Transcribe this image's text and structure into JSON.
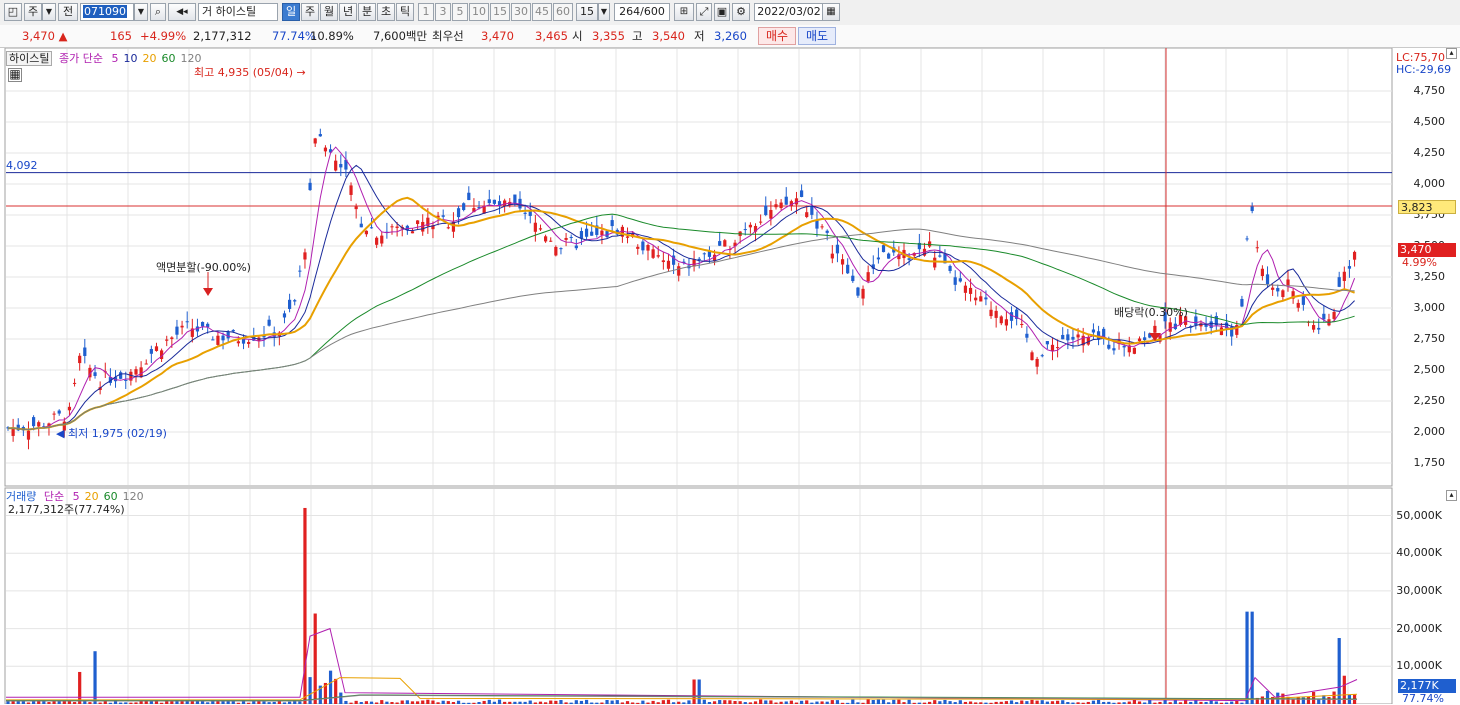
{
  "toolbar": {
    "period": "주",
    "prev": "전",
    "code": "071090",
    "name": "하이스틸",
    "name_prefix": "거",
    "tabs": [
      "일",
      "주",
      "월",
      "년",
      "분",
      "초",
      "틱"
    ],
    "active_tab": "일",
    "intervals": [
      "1",
      "3",
      "5",
      "10",
      "15",
      "30",
      "45",
      "60"
    ],
    "interval_select": "15",
    "count": "264/600",
    "date": "2022/03/02"
  },
  "quote": {
    "price": "3,470",
    "change": "165",
    "change_pct": "+4.99%",
    "volume": "2,177,312",
    "volume_ratio": "77.74%",
    "turnover": "10.89%",
    "amount": "7,600백만",
    "best_label": "최우선",
    "best_ask": "3,470",
    "best_bid": "3,465",
    "open_label": "시",
    "open": "3,355",
    "high_label": "고",
    "high": "3,540",
    "low_label": "저",
    "low": "3,260",
    "buy_button": "매수",
    "sell_button": "매도"
  },
  "price_panel": {
    "title": "하이스틸",
    "legend_label": "종가 단순",
    "ma": [
      {
        "p": "5",
        "color": "#b020b0"
      },
      {
        "p": "10",
        "color": "#1a2a9a"
      },
      {
        "p": "20",
        "color": "#e8a000"
      },
      {
        "p": "60",
        "color": "#1a8a2a"
      },
      {
        "p": "120",
        "color": "#808080"
      }
    ],
    "annotation_high": "최고 4,935 (05/04)",
    "annotation_low": "최저 1,975 (02/19)",
    "annotation_split": "액면분할(-90.00%)",
    "annotation_dividend": "배당락(0.30%)",
    "hline_blue_label": "4,092",
    "hline_blue_value": 4092,
    "hline_red_value": 3823,
    "lc": "LC:75,70",
    "hc": "HC:-29,69",
    "tag_3823": "3,823",
    "tag_price": "3,470",
    "tag_pct": "4.99%",
    "y_ticks": [
      "4,750",
      "4,500",
      "4,250",
      "4,000",
      "3,750",
      "3,500",
      "3,250",
      "3,000",
      "2,750",
      "2,500",
      "2,250",
      "2,000",
      "1,750"
    ],
    "y_values": [
      4750,
      4500,
      4250,
      4000,
      3750,
      3500,
      3250,
      3000,
      2750,
      2500,
      2250,
      2000,
      1750
    ]
  },
  "volume_panel": {
    "title": "거래량",
    "legend_label": "단순",
    "ma": [
      {
        "p": "5",
        "color": "#b020b0"
      },
      {
        "p": "20",
        "color": "#e8a000"
      },
      {
        "p": "60",
        "color": "#1a8a2a"
      },
      {
        "p": "120",
        "color": "#808080"
      }
    ],
    "current": "2,177,312주(77.74%)",
    "y_ticks": [
      "50,000K",
      "40,000K",
      "30,000K",
      "20,000K",
      "10,000K"
    ],
    "y_values": [
      50000,
      40000,
      30000,
      20000,
      10000
    ],
    "tag_volume": "2,177K",
    "tag_pct": "77.74%"
  },
  "colors": {
    "up": "#e02020",
    "down": "#1f5fcf",
    "blue_line": "#1a2a9a",
    "red_line": "#d83030"
  }
}
